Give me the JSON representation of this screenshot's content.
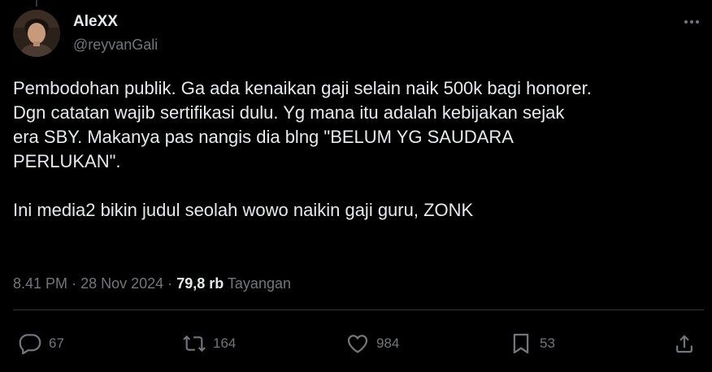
{
  "author": {
    "display_name": "AleXX",
    "handle": "@reyvanGali"
  },
  "tweet": {
    "paragraphs": [
      "Pembodohan publik. Ga ada kenaikan gaji selain naik 500k bagi honorer.\nDgn catatan wajib sertifikasi dulu. Yg mana itu adalah kebijakan sejak\nera SBY. Makanya pas nangis dia blng \"BELUM YG SAUDARA\nPERLUKAN\".",
      "Ini media2 bikin judul seolah wowo naikin gaji guru, ZONK"
    ]
  },
  "meta": {
    "time": "8.41 PM",
    "date": "28 Nov 2024",
    "separator": "·",
    "views_count": "79,8 rb",
    "views_label": "Tayangan"
  },
  "actions": {
    "replies": "67",
    "reposts": "164",
    "likes": "984",
    "bookmarks": "53"
  },
  "icons": {
    "more": "more-horizontal-icon",
    "reply": "reply-icon",
    "repost": "repost-icon",
    "like": "heart-icon",
    "bookmark": "bookmark-icon",
    "share": "share-icon"
  },
  "colors": {
    "background": "#000000",
    "text_primary": "#e7e9ea",
    "text_secondary": "#71767b",
    "divider": "#2f3336"
  }
}
